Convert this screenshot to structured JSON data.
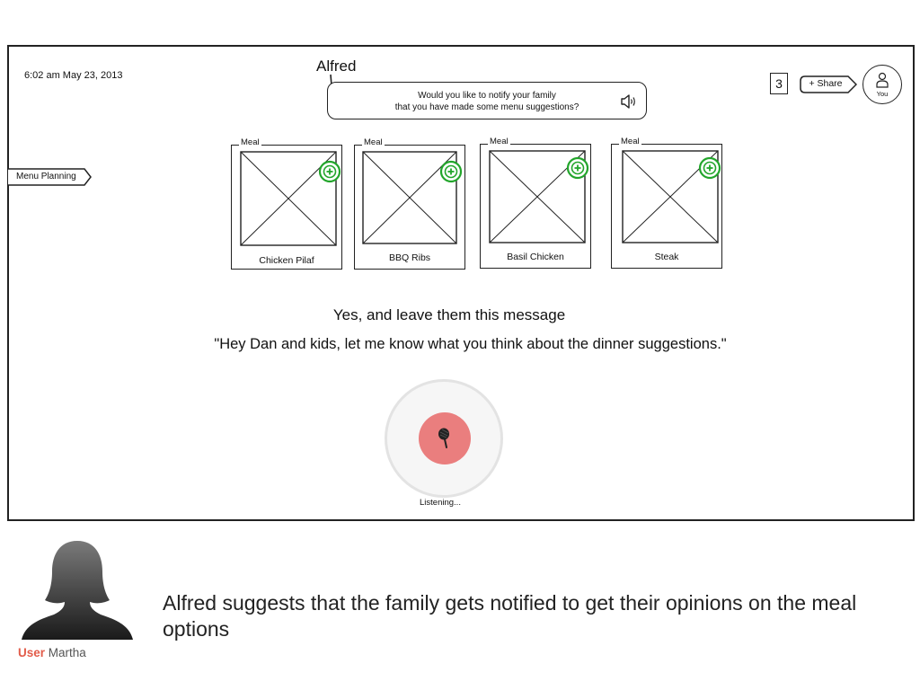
{
  "header": {
    "timestamp": "6:02 am May 23, 2013",
    "assistant_name": "Alfred",
    "notification_count": "3",
    "share_label": "+ Share",
    "avatar_label": "You"
  },
  "bubble": {
    "lines": [
      "Would you like to notify your family",
      "that you have made some menu suggestions?"
    ]
  },
  "sidebar": {
    "tab_label": "Menu Planning"
  },
  "meals": [
    {
      "tag": "Meal",
      "name": "Chicken Pilaf"
    },
    {
      "tag": "Meal",
      "name": "BBQ Ribs"
    },
    {
      "tag": "Meal",
      "name": "Basil Chicken"
    },
    {
      "tag": "Meal",
      "name": "Steak"
    }
  ],
  "conversation": {
    "response": "Yes, and leave them this message",
    "quote": "\"Hey Dan and kids, let me know what you think about the dinner suggestions.\""
  },
  "mic": {
    "status": "Listening..."
  },
  "persona": {
    "role": "User",
    "name": "Martha",
    "caption": "Alfred suggests that the family gets notified to get their opinions on the meal options"
  },
  "colors": {
    "add_icon": "#22a52b",
    "mic_button": "#ea7e7e",
    "user_role": "#e25c4a"
  },
  "icons": [
    "speaker-icon",
    "add-icon",
    "microphone-icon",
    "user-icon",
    "persona-silhouette"
  ]
}
